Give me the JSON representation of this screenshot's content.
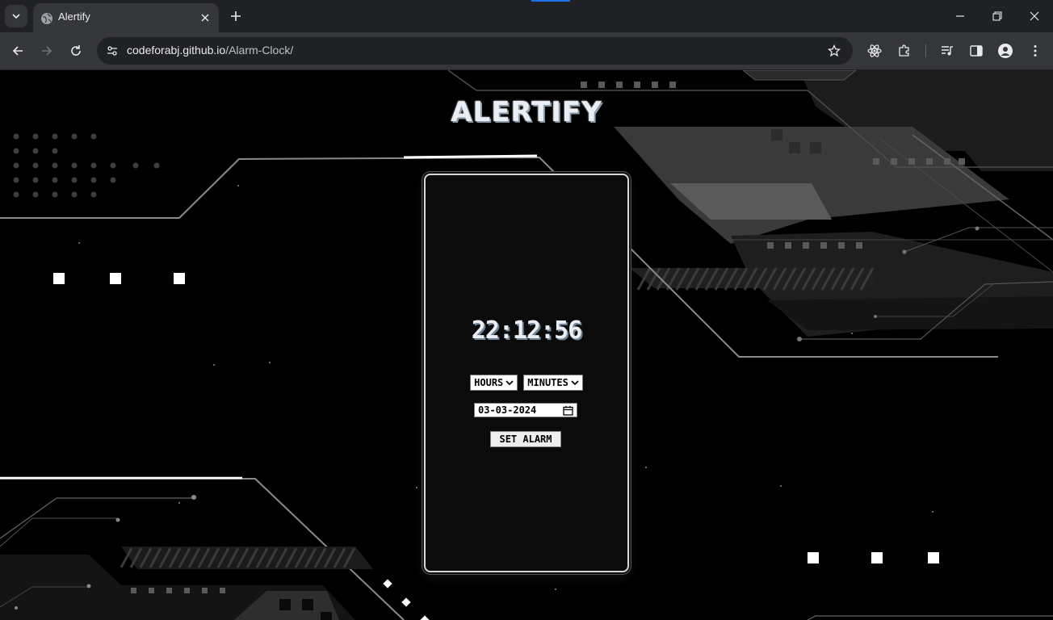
{
  "browser": {
    "tab_title": "Alertify",
    "url_host": "codeforabj.github.io",
    "url_path": "/Alarm-Clock/"
  },
  "app": {
    "title": "ALERTIFY",
    "time": "22:12:56",
    "hours_label": "HOURS",
    "minutes_label": "MINUTES",
    "date_value": "03-03-2024",
    "set_alarm_label": "SET ALARM"
  },
  "colors": {
    "chrome_dark": "#202124",
    "chrome_toolbar": "#35363a",
    "page_bg": "#000000",
    "card_bg": "#0b0b0c"
  }
}
